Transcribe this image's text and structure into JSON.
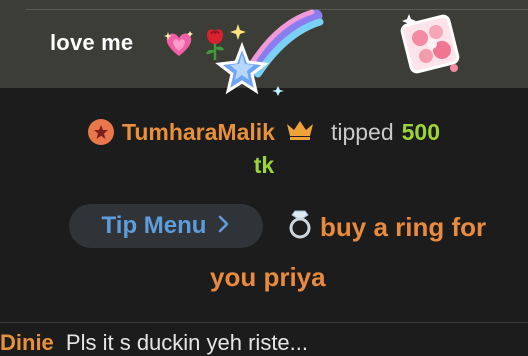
{
  "previous_message": {
    "text": "love me",
    "emojis": [
      "sparkling-heart-icon",
      "rose-icon"
    ],
    "stickers": [
      "shooting-star-sticker",
      "flower-gift-sticker"
    ]
  },
  "tip_notification": {
    "username": "TumharaMalik",
    "badge_icon": "star-badge-icon",
    "crown_icon": "crown-icon",
    "action": "tipped",
    "amount": "500",
    "unit": "tk"
  },
  "tip_menu": {
    "button_label": "Tip Menu",
    "item_icon": "ring-icon",
    "item_line1": "buy a ring for",
    "item_line2": "you priya"
  },
  "next_message": {
    "username": "Dinie",
    "text": "Pls it s duckin yeh riste..."
  },
  "colors": {
    "username": "#e8903a",
    "amount": "#9cd43b",
    "tip_menu": "#5e9ddb",
    "ring_item": "#ea8a3f",
    "top_panel": "#3b3d36",
    "background": "#1b1c1b"
  }
}
